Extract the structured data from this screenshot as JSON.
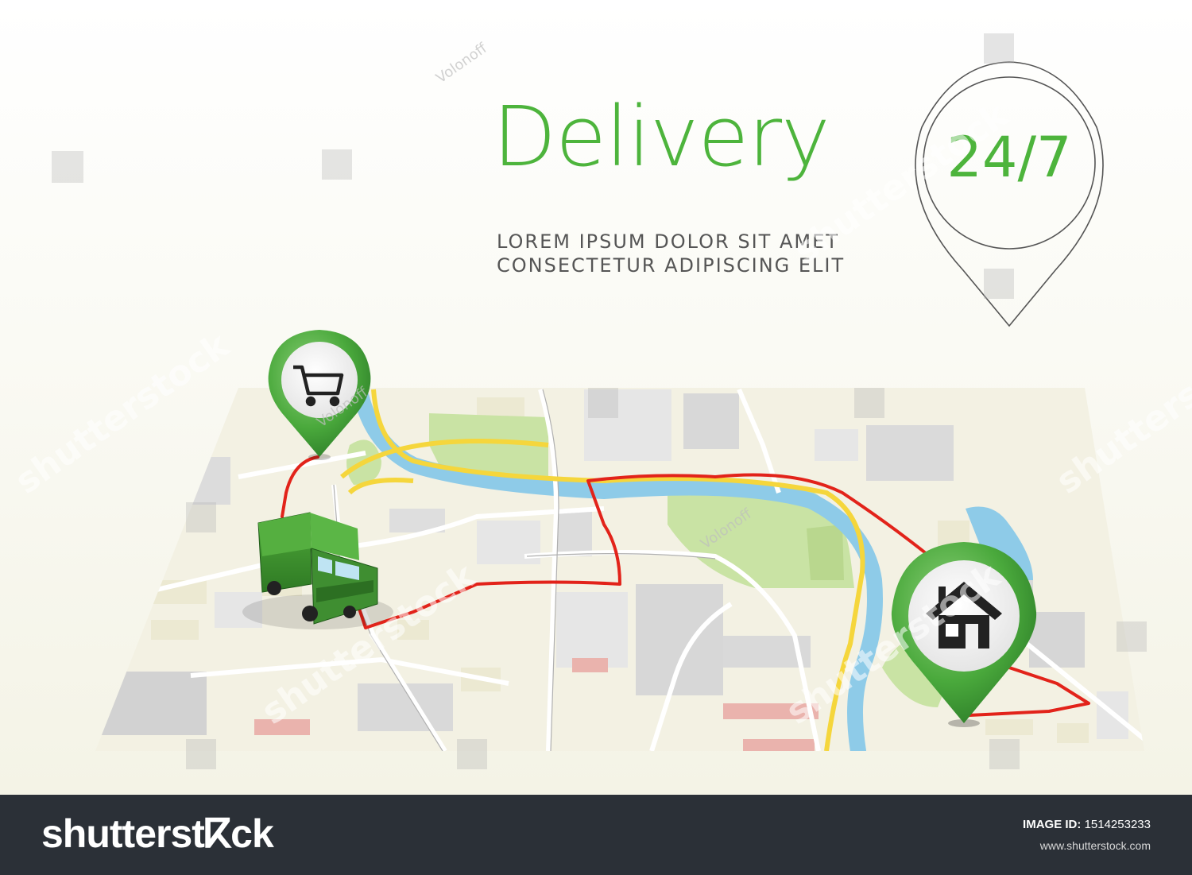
{
  "headline": "Delivery",
  "subtitle": [
    "LOREM  IPSUM  DOLOR  SIT  AMET",
    "CONSECTETUR  ADIPISCING  ELIT"
  ],
  "hours": "24/7",
  "watermarks": {
    "brand": "shutterstock",
    "author": "Volonoff"
  },
  "footer": {
    "brand": "shutterstⴽck",
    "image_id_label": "IMAGE ID:",
    "image_id": "1514253233",
    "site": "www.shutterstock.com"
  },
  "icons": [
    "cart-icon",
    "home-icon",
    "truck-icon",
    "map-pin-icon"
  ],
  "colors": {
    "accent_green": "#4db43c",
    "pin_green": "#3f9d35",
    "route_red": "#e2231a",
    "river_blue": "#8ecbe8",
    "road_yellow": "#f5d63c",
    "park_green": "#c9e3a4",
    "footer_bg": "#2b3037"
  }
}
